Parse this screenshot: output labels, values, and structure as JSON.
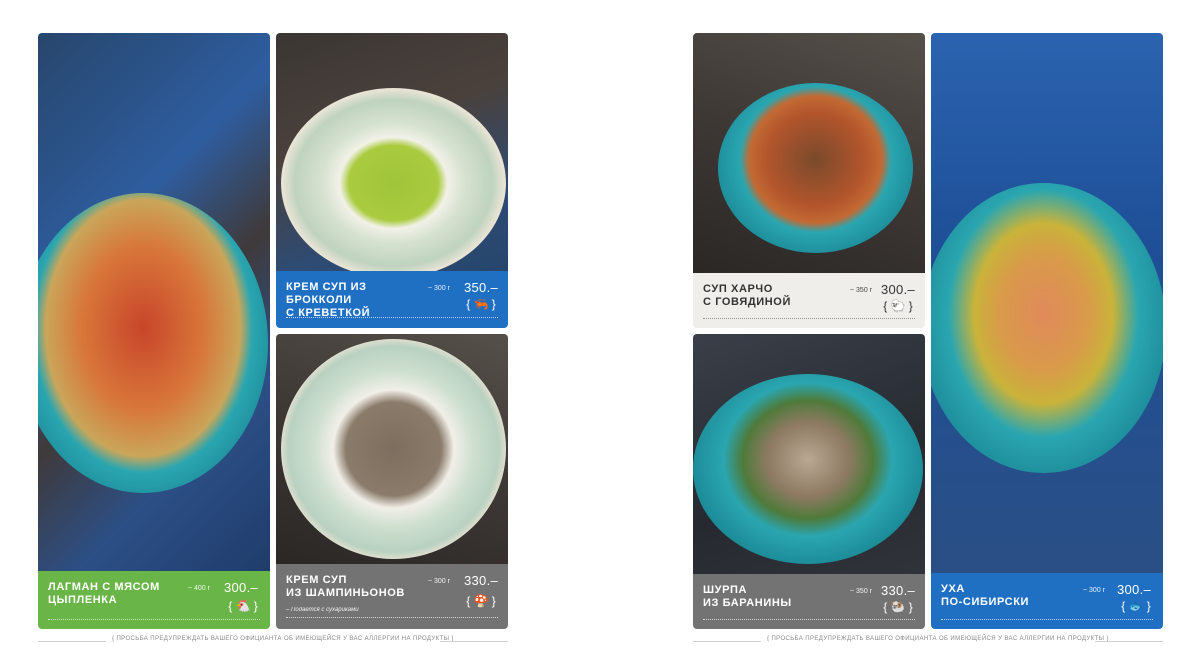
{
  "left_page": {
    "items": [
      {
        "name_line1": "ЛАГМАН С МЯСОМ",
        "name_line2": "ЦЫПЛЕНКА",
        "weight": "~ 400 г",
        "price": "300.–",
        "icon": "chicken-icon",
        "label_color": "#6ab547"
      },
      {
        "name_line1": "КРЕМ СУП ИЗ БРОККОЛИ",
        "name_line2": "С КРЕВЕТКОЙ",
        "weight": "~ 300 г",
        "price": "350.–",
        "icon": "shrimp-icon",
        "label_color": "#1f6fc3"
      },
      {
        "name_line1": "КРЕМ СУП",
        "name_line2": "ИЗ ШАМПИНЬОНОВ",
        "weight": "~ 300 г",
        "price": "330.–",
        "icon": "mushroom-icon",
        "label_color": "#737373",
        "note": "– Подается с сухариками"
      }
    ],
    "footer": "{ ПРОСЬБА ПРЕДУПРЕЖДАТЬ ВАШЕГО ОФИЦИАНТА ОБ ИМЕЮЩЕЙСЯ У ВАС АЛЛЕРГИИ НА ПРОДУКТЫ }"
  },
  "right_page": {
    "items": [
      {
        "name_line1": "СУП ХАРЧО",
        "name_line2": "С ГОВЯДИНОЙ",
        "weight": "~ 350 г",
        "price": "300.–",
        "icon": "sheep-icon",
        "label_color": "#f0eeeb"
      },
      {
        "name_line1": "ШУРПА",
        "name_line2": "ИЗ БАРАНИНЫ",
        "weight": "~ 350 г",
        "price": "330.–",
        "icon": "lamb-icon",
        "label_color": "#737373"
      },
      {
        "name_line1": "УХА",
        "name_line2": "ПО-СИБИРСКИ",
        "weight": "~ 300 г",
        "price": "300.–",
        "icon": "fish-icon",
        "label_color": "#1f6fc3"
      }
    ],
    "footer": "{ ПРОСЬБА ПРЕДУПРЕЖДАТЬ ВАШЕГО ОФИЦИАНТА ОБ ИМЕЮЩЕЙСЯ У ВАС АЛЛЕРГИИ НА ПРОДУКТЫ }"
  }
}
